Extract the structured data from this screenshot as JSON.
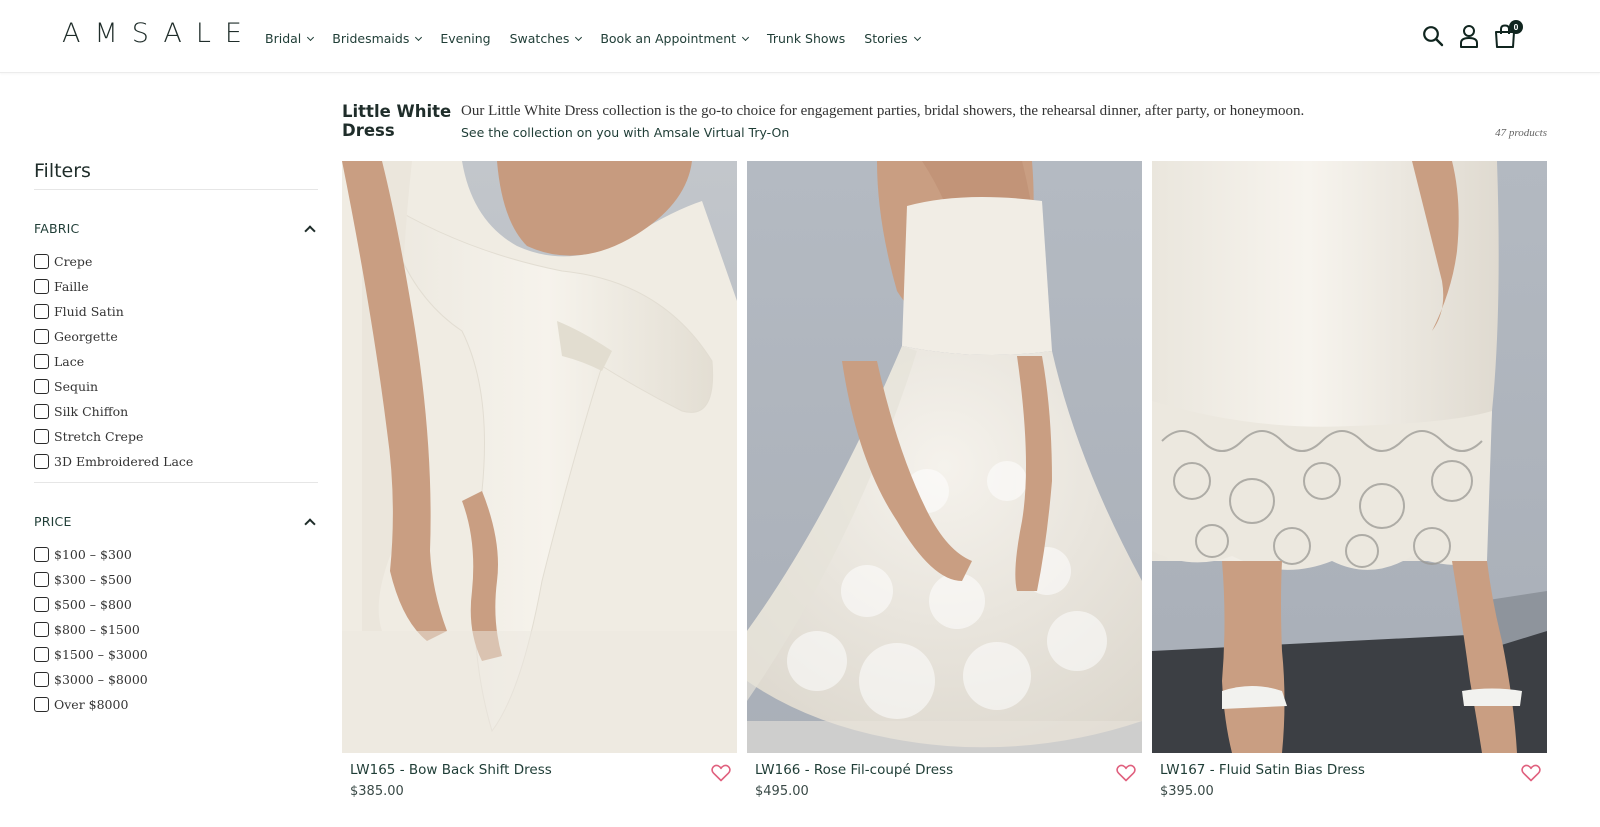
{
  "brand": {
    "logo": "AMSALE"
  },
  "nav": [
    {
      "label": "Bridal",
      "dropdown": true
    },
    {
      "label": "Bridesmaids",
      "dropdown": true
    },
    {
      "label": "Evening",
      "dropdown": false
    },
    {
      "label": "Swatches",
      "dropdown": true
    },
    {
      "label": "Book an Appointment",
      "dropdown": true
    },
    {
      "label": "Trunk Shows",
      "dropdown": false
    },
    {
      "label": "Stories",
      "dropdown": true
    }
  ],
  "header_icons": [
    "search-icon",
    "account-icon",
    "cart-icon"
  ],
  "cart": {
    "count": "0"
  },
  "filters": {
    "title": "Filters",
    "groups": [
      {
        "title": "FABRIC",
        "options": [
          "Crepe",
          "Faille",
          "Fluid Satin",
          "Georgette",
          "Lace",
          "Sequin",
          "Silk Chiffon",
          "Stretch Crepe",
          "3D Embroidered Lace"
        ]
      },
      {
        "title": "PRICE",
        "options": [
          "$100 – $300",
          "$300 – $500",
          "$500 – $800",
          "$800 – $1500",
          "$1500 – $3000",
          "$3000 – $8000",
          "Over $8000"
        ]
      }
    ]
  },
  "collection": {
    "title": "Little White Dress",
    "description": "Our Little White Dress collection is the go-to choice for engagement parties, bridal showers, the rehearsal dinner, after party, or honeymoon.",
    "link": "See the collection on you with Amsale Virtual Try-On",
    "count": "47 products"
  },
  "products": [
    {
      "name": "LW165 - Bow Back Shift Dress",
      "price": "$385.00"
    },
    {
      "name": "LW166 - Rose Fil-coupé Dress",
      "price": "$495.00"
    },
    {
      "name": "LW167 - Fluid Satin Bias Dress",
      "price": "$395.00"
    }
  ],
  "colors": {
    "text": "#1f3d36",
    "heart": "#e0607e",
    "wall": "#b7bcc2",
    "dress": "#f1ede3",
    "skin": "#c99e82"
  }
}
